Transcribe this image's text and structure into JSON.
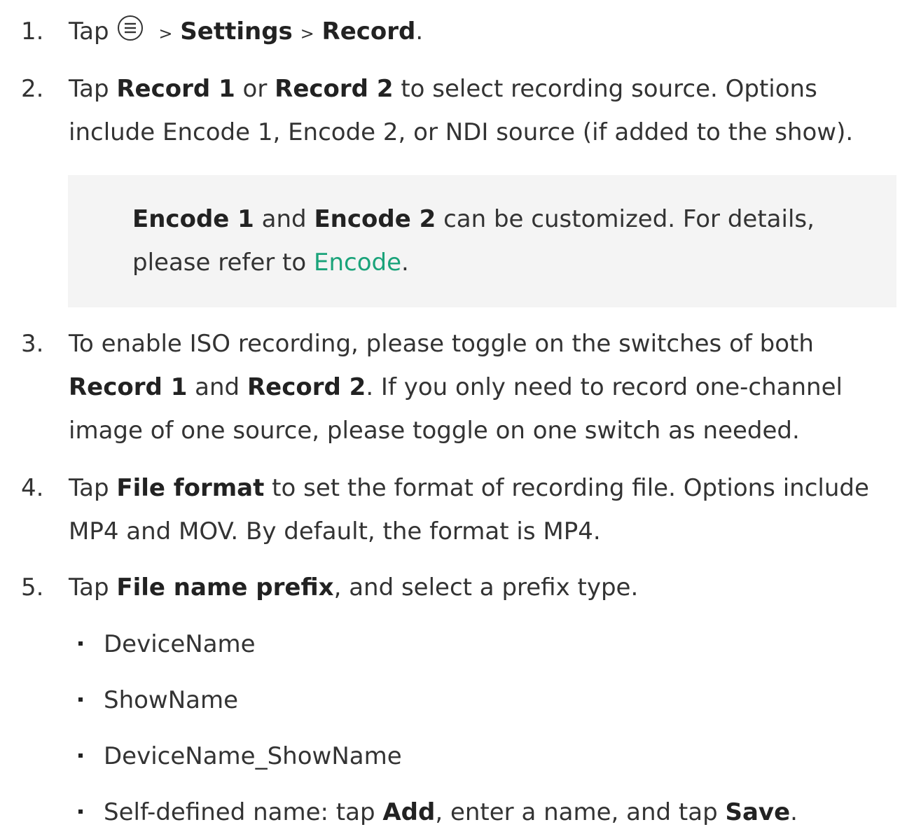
{
  "steps": {
    "s1": {
      "num": "1.",
      "tap": "Tap",
      "sep1": ">",
      "settings": "Settings",
      "sep2": ">",
      "record": "Record",
      "end": "."
    },
    "s2": {
      "num": "2.",
      "tap": "Tap",
      "record1": "Record 1",
      "or": "or",
      "record2": "Record 2",
      "rest": "to select recording source. Options include Encode 1, Encode 2, or NDI source (if added to the show)."
    },
    "note": {
      "encode1": "Encode 1",
      "and": "and",
      "encode2": "Encode 2",
      "rest": "can be customized. For details, please refer to",
      "link": "Encode",
      "end": "."
    },
    "s3": {
      "num": "3.",
      "intro": "To enable ISO recording, please toggle on the switches of both",
      "record1": "Record 1",
      "and": "and",
      "record2": "Record 2",
      "rest": ". If you only need to record one-channel image of one source, please toggle on one switch as needed."
    },
    "s4": {
      "num": "4.",
      "tap": "Tap",
      "file_format": "File format",
      "rest": "to set the format of recording file. Options include MP4 and MOV. By default, the format is MP4."
    },
    "s5": {
      "num": "5.",
      "tap": "Tap",
      "prefix": "File name prefix",
      "rest": ", and select a prefix type."
    }
  },
  "bullets": {
    "b1": "DeviceName",
    "b2": "ShowName",
    "b3": "DeviceName_ShowName",
    "b4": {
      "intro": "Self-defined name: tap",
      "add": "Add",
      "mid": ", enter a name, and tap",
      "save": "Save",
      "end": "."
    }
  },
  "icons": {
    "menu": "menu-circle-icon"
  }
}
